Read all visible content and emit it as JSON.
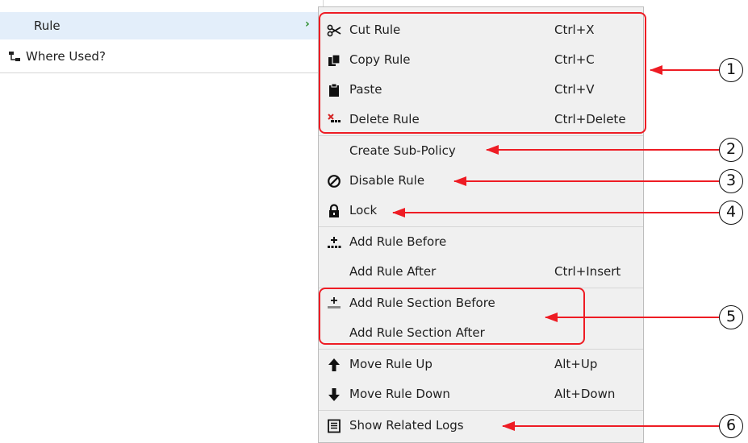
{
  "parent_menu": {
    "items": [
      {
        "label": "Rule",
        "icon": "none",
        "highlighted": true,
        "has_submenu": true
      },
      {
        "label": "Where Used?",
        "icon": "where-used-icon",
        "highlighted": false
      }
    ],
    "submenu_arrow": "›"
  },
  "context_menu": {
    "items": [
      {
        "label": "Cut Rule",
        "shortcut": "Ctrl+X",
        "icon": "scissors-icon"
      },
      {
        "label": "Copy Rule",
        "shortcut": "Ctrl+C",
        "icon": "copy-icon"
      },
      {
        "label": "Paste",
        "shortcut": "Ctrl+V",
        "icon": "paste-icon"
      },
      {
        "label": "Delete Rule",
        "shortcut": "Ctrl+Delete",
        "icon": "delete-icon"
      },
      {
        "label": "Create Sub-Policy",
        "shortcut": "",
        "icon": "none"
      },
      {
        "label": "Disable Rule",
        "shortcut": "",
        "icon": "disable-icon"
      },
      {
        "label": "Lock",
        "shortcut": "",
        "icon": "lock-icon"
      },
      {
        "label": "Add Rule Before",
        "shortcut": "",
        "icon": "add-rule-before-icon"
      },
      {
        "label": "Add Rule After",
        "shortcut": "Ctrl+Insert",
        "icon": "none"
      },
      {
        "label": "Add Rule Section Before",
        "shortcut": "",
        "icon": "add-section-icon"
      },
      {
        "label": "Add Rule Section After",
        "shortcut": "",
        "icon": "none"
      },
      {
        "label": "Move Rule Up",
        "shortcut": "Alt+Up",
        "icon": "arrow-up-icon"
      },
      {
        "label": "Move Rule Down",
        "shortcut": "Alt+Down",
        "icon": "arrow-down-icon"
      },
      {
        "label": "Show Related Logs",
        "shortcut": "",
        "icon": "logs-icon"
      }
    ]
  },
  "callouts": [
    {
      "number": "1"
    },
    {
      "number": "2"
    },
    {
      "number": "3"
    },
    {
      "number": "4"
    },
    {
      "number": "5"
    },
    {
      "number": "6"
    }
  ],
  "colors": {
    "annotation_red": "#ee1c24",
    "highlight_blue": "#e3eefa",
    "menu_background": "#f0f0f0",
    "submenu_arrow_green": "#2a8c2a",
    "delete_icon_red": "#d42020"
  }
}
